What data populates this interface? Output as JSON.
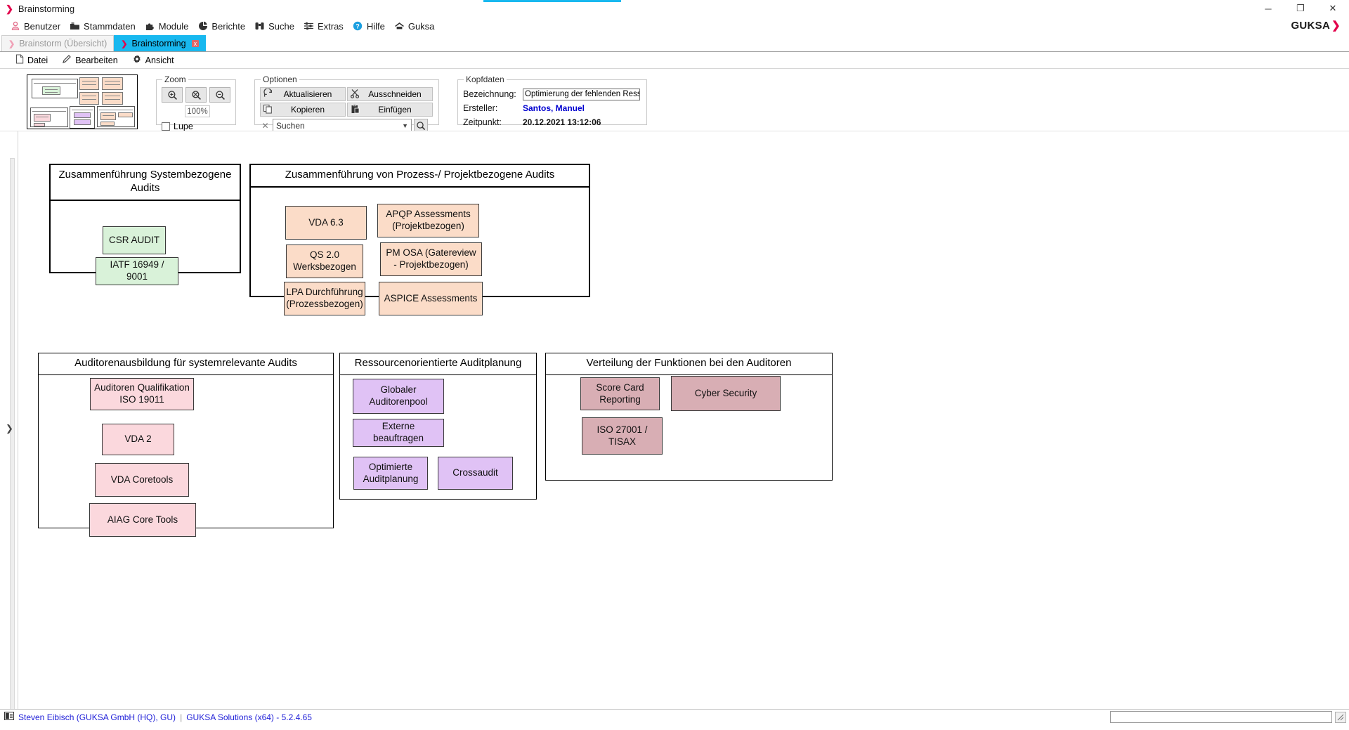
{
  "window": {
    "title": "Brainstorming",
    "minimize": "─",
    "maximize": "❐",
    "close": "✕"
  },
  "menubar": {
    "items": [
      {
        "label": "Benutzer",
        "icon": "user-icon"
      },
      {
        "label": "Stammdaten",
        "icon": "folder-icon"
      },
      {
        "label": "Module",
        "icon": "puzzle-icon"
      },
      {
        "label": "Berichte",
        "icon": "pie-chart-icon"
      },
      {
        "label": "Suche",
        "icon": "binoculars-icon"
      },
      {
        "label": "Extras",
        "icon": "sliders-icon"
      },
      {
        "label": "Hilfe",
        "icon": "help-icon"
      },
      {
        "label": "Guksa",
        "icon": "home-icon"
      }
    ],
    "brand": "GUKSA",
    "brand_chevron": "❯"
  },
  "tabs": [
    {
      "label": "Brainstorm (Übersicht)",
      "active": false,
      "closable": false
    },
    {
      "label": "Brainstorming",
      "active": true,
      "closable": true,
      "close_label": "x"
    }
  ],
  "submenu": [
    {
      "label": "Datei",
      "icon": "file-icon"
    },
    {
      "label": "Bearbeiten",
      "icon": "pencil-icon"
    },
    {
      "label": "Ansicht",
      "icon": "gear-icon"
    }
  ],
  "ribbon": {
    "zoom": {
      "legend": "Zoom",
      "buttons": [
        {
          "name": "zoom-in",
          "icon": "magnifier-plus-icon"
        },
        {
          "name": "zoom-fit",
          "icon": "magnifier-fit-icon"
        },
        {
          "name": "zoom-out",
          "icon": "magnifier-minus-icon"
        }
      ],
      "percent": "100%",
      "lupe_label": "Lupe",
      "lupe_checked": false
    },
    "optionen": {
      "legend": "Optionen",
      "aktualisieren": "Aktualisieren",
      "ausschneiden": "Ausschneiden",
      "kopieren": "Kopieren",
      "einfuegen": "Einfügen",
      "search_value": "Suchen",
      "search_placeholder": "Suchen",
      "clear_label": "✕"
    },
    "kopfdaten": {
      "legend": "Kopfdaten",
      "bezeichnung_label": "Bezeichnung:",
      "bezeichnung_value": "Optimierung der fehlenden Ressourcen bzgl.",
      "ersteller_label": "Ersteller:",
      "ersteller_value": "Santos, Manuel",
      "zeitpunkt_label": "Zeitpunkt:",
      "zeitpunkt_value": "20.12.2021 13:12:06"
    }
  },
  "diagram": {
    "groups": [
      {
        "id": "systembezogene-audits",
        "title": "Zusammenführung Systembezogene Audits",
        "nodes": [
          {
            "label": "CSR AUDIT",
            "color": "green"
          },
          {
            "label": "IATF 16949 / 9001",
            "color": "green"
          }
        ]
      },
      {
        "id": "prozess-projektbezogene-audits",
        "title": "Zusammenführung von Prozess-/ Projektbezogene  Audits",
        "nodes": [
          {
            "label": "VDA 6.3",
            "color": "orange"
          },
          {
            "label": "APQP Assessments (Projektbezogen)",
            "color": "orange"
          },
          {
            "label": "QS 2.0 Werksbezogen",
            "color": "orange"
          },
          {
            "label": "PM OSA (Gatereview - Projektbezogen)",
            "color": "orange"
          },
          {
            "label": "LPA Durchführung (Prozessbezogen)",
            "color": "orange"
          },
          {
            "label": "ASPICE Assessments",
            "color": "orange"
          }
        ]
      },
      {
        "id": "auditorenausbildung",
        "title": "Auditorenausbildung für systemrelevante Audits",
        "nodes": [
          {
            "label": "Auditoren Qualifikation ISO 19011",
            "color": "pink"
          },
          {
            "label": "VDA 2",
            "color": "pink"
          },
          {
            "label": "VDA Coretools",
            "color": "pink"
          },
          {
            "label": "AIAG Core Tools",
            "color": "pink"
          }
        ]
      },
      {
        "id": "ressourcenorientierte-auditplanung",
        "title": "Ressourcenorientierte Auditplanung",
        "nodes": [
          {
            "label": "Globaler Auditorenpool",
            "color": "purple"
          },
          {
            "label": "Externe beauftragen",
            "color": "purple"
          },
          {
            "label": "Optimierte Auditplanung",
            "color": "purple"
          },
          {
            "label": "Crossaudit",
            "color": "purple"
          }
        ]
      },
      {
        "id": "verteilung-funktionen",
        "title": "Verteilung der Funktionen bei den Auditoren",
        "nodes": [
          {
            "label": "Score Card Reporting",
            "color": "mauve"
          },
          {
            "label": "Cyber Security",
            "color": "mauve"
          },
          {
            "label": "ISO 27001 / TISAX",
            "color": "mauve"
          }
        ]
      }
    ]
  },
  "statusbar": {
    "user": "Steven Eibisch (GUKSA GmbH (HQ), GU)",
    "separator": "|",
    "product": "GUKSA Solutions (x64) - 5.2.4.65",
    "field_value": ""
  }
}
